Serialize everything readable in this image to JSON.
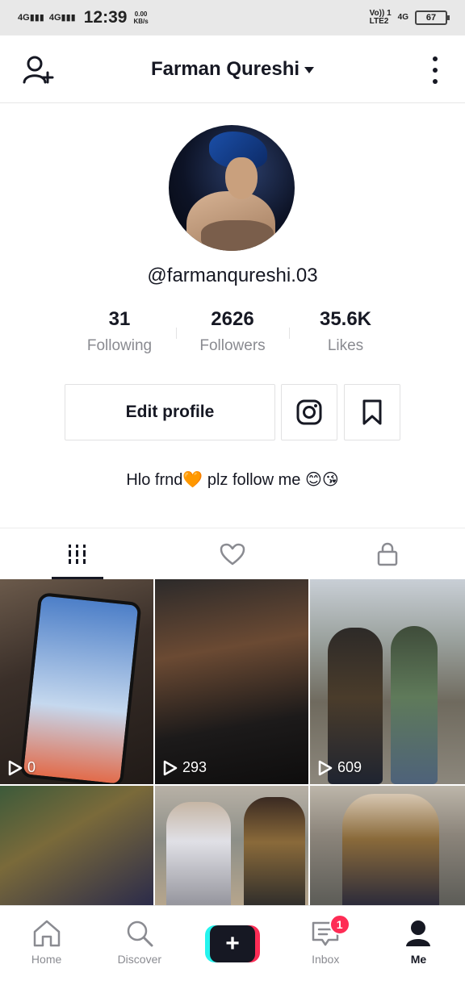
{
  "status_bar": {
    "network_left": "4G",
    "time": "12:39",
    "speed_value": "0.00",
    "speed_unit": "KB/s",
    "volte": "Vo)) 1",
    "lte": "LTE2",
    "network_right": "4G",
    "battery": "67"
  },
  "header": {
    "title": "Farman Qureshi"
  },
  "profile": {
    "username": "@farmanqureshi.03",
    "stats": [
      {
        "value": "31",
        "label": "Following"
      },
      {
        "value": "2626",
        "label": "Followers"
      },
      {
        "value": "35.6K",
        "label": "Likes"
      }
    ],
    "edit_label": "Edit profile",
    "bio": "Hlo frnd🧡 plz follow me 😊😘"
  },
  "videos": [
    {
      "views": "0"
    },
    {
      "views": "293"
    },
    {
      "views": "609"
    }
  ],
  "nav": {
    "home": "Home",
    "discover": "Discover",
    "inbox": "Inbox",
    "inbox_badge": "1",
    "me": "Me",
    "create": "+"
  },
  "colors": {
    "accent_red": "#fe2c55",
    "accent_cyan": "#25f4ee",
    "text": "#161823",
    "muted": "#8a8b91"
  },
  "icons": [
    "add-user-icon",
    "caret-down-icon",
    "more-vertical-icon",
    "instagram-icon",
    "bookmark-icon",
    "grid-icon",
    "heart-icon",
    "lock-icon",
    "play-icon",
    "home-icon",
    "search-icon",
    "inbox-icon",
    "me-icon"
  ]
}
